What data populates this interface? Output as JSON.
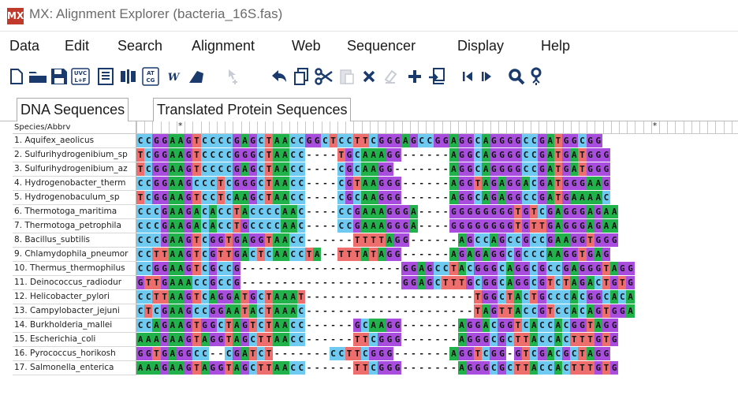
{
  "window": {
    "title": "MX: Alignment Explorer (bacteria_16S.fas)",
    "logo": "MX"
  },
  "menu": [
    "Data",
    "Edit",
    "Search",
    "Alignment",
    "Web",
    "Sequencer",
    "Display",
    "Help"
  ],
  "toolbar": [
    "new-file-icon",
    "open-folder-icon",
    "save-icon",
    "uvc-to-lf-icon",
    "text-view-icon",
    "bars-icon",
    "atcg-icon",
    "w-icon",
    "toggle-icon",
    "cursor-icon",
    "back-arrow-icon",
    "copy-icon",
    "cut-icon",
    "paste-icon",
    "delete-icon",
    "clear-icon",
    "add-icon",
    "insert-icon",
    "previous-icon",
    "next-icon",
    "search-icon",
    "find-replace-icon"
  ],
  "tabs": {
    "dna": "DNA Sequences",
    "protein": "Translated Protein Sequences"
  },
  "grid": {
    "header": "Species/Abbrv",
    "star": "*"
  },
  "species": [
    {
      "name": "1. Aquifex_aeolicus",
      "seq": "CCGGAAGTCCCCGAGCTAACCGGCTCCTTCGGGAGCCGGAGGCAGGGGCCGATGGCGG"
    },
    {
      "name": "2. Sulfurihydrogenibium_sp",
      "seq": "TCGGAAGTCCCCGGGCTAACC----TGCAAAGG------AGGCAGGGGCCGATGATGGG"
    },
    {
      "name": "3. Sulfurihydrogenibium_az",
      "seq": "TCGGAAGTCCCCGAGCTAACC----CGCAAGG-------AGGCAGGGGCCGATGATGGG"
    },
    {
      "name": "4. Hydrogenobacter_therm",
      "seq": "CCGGAAGCCCTCGGGCTAACC----CGTAAGGG------AGGTAGAGGACGATGGGAAG"
    },
    {
      "name": "5. Hydrogenobaculum_sp",
      "seq": "TCGGAAGTCCTCAAGCTAACC----CGCAAGGG------AGGCAGAGGCCGATGAAAAC"
    },
    {
      "name": "6. Thermotoga_maritima",
      "seq": "CCCGAAGACACCTACCCCAAC----CCGAAAGGGA----GGGGGGGGTGTCGAGGGAGAA"
    },
    {
      "name": "7. Thermotoga_petrophila",
      "seq": "CCCGAAGACACCTGCCCCAAC----CCGAAAGGGA----GGGGGGGGTGTTGAGGGAGAA"
    },
    {
      "name": "8. Bacillus_subtilis",
      "seq": "CCCGAAGTCGGTGAGGTAACC------TTTTAGG------AGCCAGCCGCCGAAGGTGGG"
    },
    {
      "name": "9. Chlamydophila_pneumor",
      "seq": "CCTTAAGTCGTTGACTCAACCTA--TTTATAGG------AGAGAGGCGCCCAAGGTGAG"
    },
    {
      "name": "10. Thermus_thermophilus",
      "seq": "CCGGAAGTCGCCG--------------------GGAGCCTACGGGCAGGCGCCGAGGGTAGG"
    },
    {
      "name": "11. Deinococcus_radiodur",
      "seq": "GTTGAAACCGCCG--------------------GGAGCTTTGCGGCAGGCGTCTAGACTGTG"
    },
    {
      "name": "12. Helicobacter_pylori",
      "seq": "CCTTAAGTCAGGATGCTAAAT---------------------TGGCTACTGCCCACGGCACA"
    },
    {
      "name": "13. Campylobacter_jejuni",
      "seq": "CTCGAAGCCGGAATACTAAAC---------------------TAGTTACCGTCCACAGTGGA"
    },
    {
      "name": "14. Burkholderia_mallei",
      "seq": "CCAGAAGTGGCTAGTCTAACC------GCAAGG-------AGGACGGTCACCACGGTAGG"
    },
    {
      "name": "15. Escherichia_coli",
      "seq": "AAAGAAGTAGGTAGCTTAACC------TTCGGG-------AGGGCGCTTACCACTTTGTG"
    },
    {
      "name": "16. Pyrococcus_horikosh",
      "seq": "GGTGAGGCC--CGATCT-------CCTTCGGG-------AGGTCGG-GTCGACGCTAGG"
    },
    {
      "name": "17. Salmonella_enterica",
      "seq": "AAAGAAGTAGGTAGCTTAACC------TTCGGG-------AGGGCGCTTACCACTTTGTG"
    }
  ]
}
